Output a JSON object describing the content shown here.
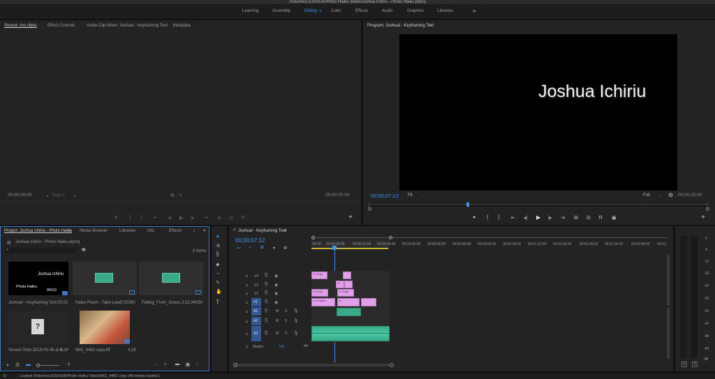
{
  "window_title": "/Volumes/JOSHUA/Photo Haiku Video/Joshua Ichiriu - Photo Haiku.prproj",
  "workspaces": [
    "Learning",
    "Assembly",
    "Editing",
    "Color",
    "Effects",
    "Audio",
    "Graphics",
    "Libraries"
  ],
  "workspace_more": "»",
  "source_panel": {
    "tabs": [
      "Source: (no clips)",
      "Effect Controls",
      "Audio Clip Mixer: Joshual - Keyframing Text",
      "Metadata"
    ],
    "timecode_left": "00;00;00;00",
    "page_label": "Page 1",
    "timecode_right": "00;00;00;00"
  },
  "program_panel": {
    "title": "Program: Joshual - Keyframing Text",
    "video_text": "Joshua Ichiriu",
    "timecode": "00;00;07;12",
    "fit": "Fit",
    "quality": "Full",
    "duration": "00;00;25;00"
  },
  "project_panel": {
    "tabs": [
      "Project: Joshua Ichiriu - Photo Haiku",
      "Media Browser",
      "Libraries",
      "Info",
      "Effects"
    ],
    "path": "Joshua Ichiriu - Photo Haiku.prproj",
    "items_count": "5 Items",
    "items": [
      {
        "name": "Joshual - Keyframing Text",
        "duration": "25;02",
        "thumb_title": "Joshua Ichiriu",
        "thumb_sub": "Photo Haiku",
        "thumb_date": "9/6/19"
      },
      {
        "name": "Haiku Poem - Take Lwav",
        "duration": "7:25380"
      },
      {
        "name": "Falling_From_Grace...",
        "duration": "2:31:34030"
      },
      {
        "name": "Screen Shot 2019-09-06 at 9...",
        "duration": "4;29"
      },
      {
        "name": "IMG_4482 copy.tiff",
        "duration": "4;29"
      }
    ]
  },
  "timeline": {
    "tab": "Joshual - Keyframing Text",
    "timecode": "00;00;07;12",
    "ruler": [
      ":00;00",
      "00;00;08;00",
      "00;00;16;00",
      "00;00;24;00",
      "00;00;32;00",
      "00;00;40;00",
      "00;00;48;00",
      "00;00;56;00",
      "00;01;04;02",
      "00;01;12;02",
      "00;01;20;02",
      "00;01;28;02",
      "00;01;36;02",
      "00;01;44;02",
      "00;01;"
    ],
    "video_tracks": [
      "V4",
      "V3",
      "V2",
      "V1"
    ],
    "audio_tracks": [
      "A1",
      "A2",
      "A3"
    ],
    "master_label": "Master",
    "master_value": "0.0",
    "clip_labels": {
      "v4": "fx Grap",
      "v3": "fx",
      "v2a": "fx Grap",
      "v2b": "fx Grap",
      "v1a": "fx Graphic",
      "v1b": "fx"
    }
  },
  "meter": {
    "scale": [
      "0",
      "-6",
      "-12",
      "-18",
      "-24",
      "-30",
      "-36",
      "-42",
      "-48",
      "-54",
      "dB"
    ],
    "solo": [
      "S",
      "S"
    ]
  },
  "status_bar": "Loaded /Volumes/JOSHUA/Photo Haiku Video/IMG_4482 copy (All media loaded.)"
}
